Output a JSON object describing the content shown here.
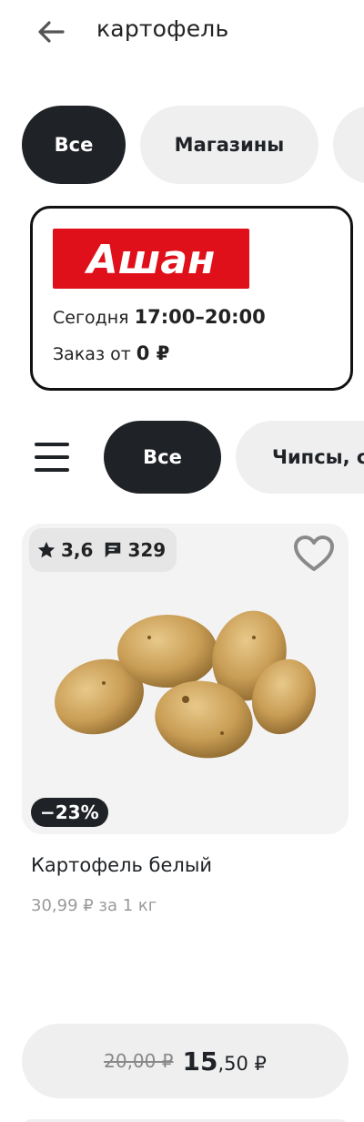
{
  "header": {
    "title": "картофель",
    "back_icon": "arrow-left-icon"
  },
  "filter_chips": [
    {
      "label": "Все",
      "active": true
    },
    {
      "label": "Магазины",
      "active": false
    }
  ],
  "store": {
    "logo_text": "Ашан",
    "brand_color": "#e0101b",
    "delivery_label": "Сегодня",
    "delivery_time": "17:00–20:00",
    "order_label": "Заказ от",
    "order_min": "0 ₽"
  },
  "categories": {
    "menu_icon": "hamburger-menu-icon",
    "items": [
      {
        "label": "Все",
        "active": true
      },
      {
        "label": "Чипсы, с",
        "active": false
      }
    ]
  },
  "product": {
    "rating": "3,6",
    "reviews": "329",
    "discount": "−23%",
    "name": "Картофель белый",
    "unit_price": "30,99 ₽ за 1 кг",
    "old_price": "20,00 ₽",
    "new_price_int": "15",
    "new_price_frac": ",50 ₽",
    "favorite_icon": "heart-outline-icon"
  },
  "colors": {
    "dark": "#1f2226",
    "light_chip": "#efefef",
    "card_bg": "#f3f3f3"
  }
}
